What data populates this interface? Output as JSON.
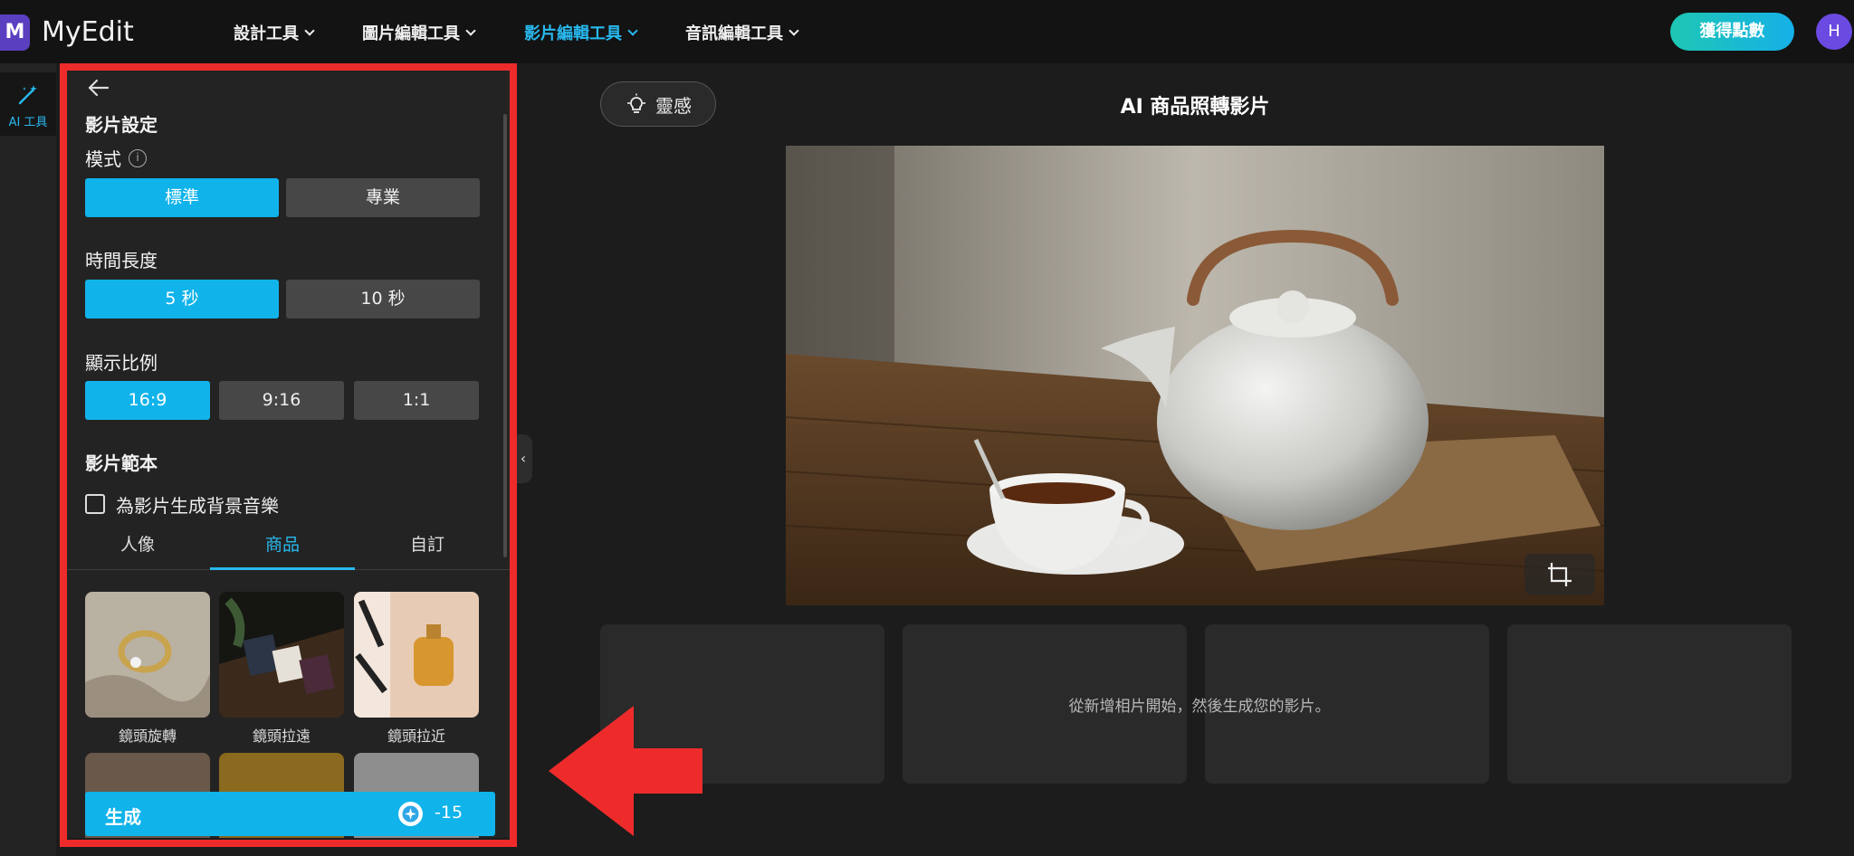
{
  "header": {
    "logo_mark": "M",
    "logo_text": "MyEdit",
    "nav": [
      {
        "label": "設計工具",
        "active": false
      },
      {
        "label": "圖片編輯工具",
        "active": false
      },
      {
        "label": "影片編輯工具",
        "active": true
      },
      {
        "label": "音訊編輯工具",
        "active": false
      }
    ],
    "points_button": "獲得點數",
    "avatar_initial": "H"
  },
  "rail": {
    "items": [
      {
        "label": "AI 工具",
        "icon": "magic-wand-icon"
      }
    ]
  },
  "panel": {
    "section_title": "影片設定",
    "mode": {
      "label": "模式",
      "options": [
        "標準",
        "專業"
      ],
      "selected": "標準"
    },
    "duration": {
      "label": "時間長度",
      "options": [
        "5 秒",
        "10 秒"
      ],
      "selected": "5 秒"
    },
    "ratio": {
      "label": "顯示比例",
      "options": [
        "16:9",
        "9:16",
        "1:1"
      ],
      "selected": "16:9"
    },
    "templates": {
      "title": "影片範本",
      "music_checkbox": {
        "label": "為影片生成背景音樂",
        "checked": false
      },
      "tabs": [
        "人像",
        "商品",
        "自訂"
      ],
      "active_tab": "商品",
      "items": [
        {
          "label": "鏡頭旋轉"
        },
        {
          "label": "鏡頭拉遠"
        },
        {
          "label": "鏡頭拉近"
        }
      ]
    },
    "generate": {
      "label": "生成",
      "credit": "-15"
    }
  },
  "main": {
    "inspiration_button": "靈感",
    "title": "AI 商品照轉影片",
    "hint": "從新增相片開始，然後生成您的影片。"
  },
  "colors": {
    "accent": "#10b3ea",
    "highlight": "#ee2b2b",
    "background": "#1c1c1c"
  }
}
